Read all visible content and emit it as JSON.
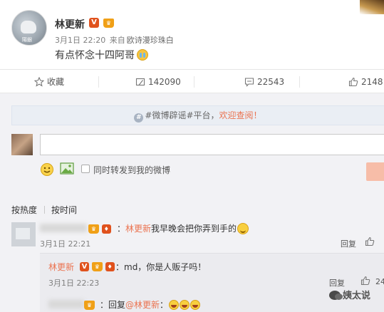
{
  "post": {
    "author": "林更新",
    "avatar_watermark": "陽銀",
    "time": "3月1日 22:20",
    "source_prefix": "来自",
    "source": "欧诗漫珍珠白",
    "text": "有点怀念十四阿哥"
  },
  "actions": {
    "favorite_label": "收藏",
    "repost_count": "142090",
    "comment_count": "22543",
    "like_count": "2148"
  },
  "banner": {
    "prefix": "#微博辟谣#平台，",
    "link": "欢迎查阅！"
  },
  "composer": {
    "repost_option": "同时转发到我的微博"
  },
  "tabs": [
    "按热度",
    "按时间"
  ],
  "comments": [
    {
      "text_prefix": "：",
      "mention": "林更新",
      "text_body": "我早晚会把你弄到手的",
      "time": "3月1日 22:21",
      "reply_label": "回复"
    }
  ],
  "replies": [
    {
      "author": "林更新",
      "text": "：md，你是人贩子吗！",
      "time": "3月1日 22:23",
      "reply_label": "回复",
      "like_count": "24"
    },
    {
      "text_prefix": "：回复",
      "mention": "@林更新",
      "text_suffix": "："
    }
  ],
  "watermark": "姨太说",
  "colors": {
    "accent": "#eb7350",
    "vip_badge": "#e0521d",
    "crown": "#f0a017",
    "comment_bg": "#f2f2f5"
  },
  "icons": {
    "favorite": "star-icon",
    "repost": "repost-icon",
    "comment": "comment-icon",
    "like": "thumbs-up-icon",
    "emoji": "smile-icon",
    "image": "image-icon"
  }
}
